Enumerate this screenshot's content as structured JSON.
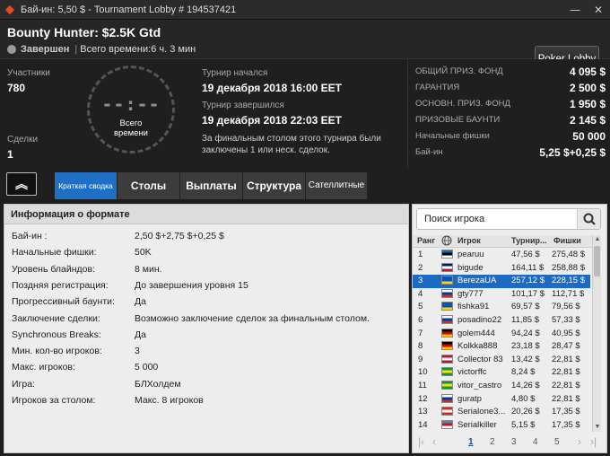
{
  "window": {
    "title": "Бай-ин: 5,50 $ - Tournament Lobby # 194537421",
    "minimize": "—",
    "close": "✕"
  },
  "header": {
    "name": "Bounty Hunter: $2.5K Gtd",
    "status": "Завершен",
    "total_time": "Всего времени:6 ч. 3 мин",
    "lobby_button": "Poker Lobby"
  },
  "info": {
    "participants_label": "Участники",
    "participants": "780",
    "deals_label": "Сделки",
    "deals": "1",
    "clock_time": "--:--",
    "clock_caption_1": "Всего",
    "clock_caption_2": "времени",
    "started_label": "Турнир начался",
    "started": "19 декабря 2018   16:00 EET",
    "ended_label": "Турнир завершился",
    "ended": "19 декабря 2018   22:03 EET",
    "note": "За финальным столом этого турнира были заключены 1 или неск. сделок."
  },
  "prizes": [
    {
      "label": "Общий приз. фонд",
      "value": "4 095 $"
    },
    {
      "label": "Гарантия",
      "value": "2 500 $"
    },
    {
      "label": "Основн. приз. фонд",
      "value": "1 950 $"
    },
    {
      "label": "Призовые баунти",
      "value": "2 145 $"
    },
    {
      "label": "Начальные фишки",
      "value": "50 000"
    },
    {
      "label": "Бай-ин",
      "value": "5,25 $+0,25 $"
    }
  ],
  "nav": {
    "up_icon": "︽",
    "tabs": [
      "Краткая сводка",
      "Столы",
      "Выплаты",
      "Структура",
      "Сателлитные"
    ]
  },
  "format": {
    "title": "Информация о формате",
    "rows": [
      {
        "k": "Бай-ин :",
        "v": "2,50 $+2,75 $+0,25 $"
      },
      {
        "k": "Начальные фишки:",
        "v": "50K"
      },
      {
        "k": "Уровень блайндов:",
        "v": "8 мин."
      },
      {
        "k": "Поздняя регистрация:",
        "v": "До завершения уровня 15"
      },
      {
        "k": "Прогрессивный баунти:",
        "v": "Да"
      },
      {
        "k": "Заключение сделки:",
        "v": "Возможно заключение сделок за финальным столом."
      },
      {
        "k": "Synchronous Breaks:",
        "v": "Да"
      },
      {
        "k": "Мин. кол-во игроков:",
        "v": "3"
      },
      {
        "k": "Макс. игроков:",
        "v": "5 000"
      },
      {
        "k": "Игра:",
        "v": "БЛХолдем"
      },
      {
        "k": "Игроков за столом:",
        "v": "Макс. 8 игроков"
      }
    ]
  },
  "players": {
    "search_placeholder": "Поиск игрока",
    "headers": {
      "rank": "Ранг",
      "player": "Игрок",
      "tourney": "Турнир...",
      "chips": "Фишки"
    },
    "rows": [
      {
        "rank": "1",
        "name": "pearuu",
        "t": "47,56 $",
        "c": "275,48 $",
        "flag": [
          "#0072ce",
          "#000000",
          "#ffffff"
        ]
      },
      {
        "rank": "2",
        "name": "bigude",
        "t": "164,11 $",
        "c": "258,88 $",
        "flag": [
          "#012169",
          "#ffffff",
          "#c8102e"
        ]
      },
      {
        "rank": "3",
        "name": "BerezaUA",
        "t": "257,12 $",
        "c": "228,15 $",
        "flag": [
          "#0057b7",
          "#0057b7",
          "#ffd700"
        ]
      },
      {
        "rank": "4",
        "name": "gty777",
        "t": "101,17 $",
        "c": "112,71 $",
        "flag": [
          "#ffffff",
          "#0039a6",
          "#d52b1e"
        ]
      },
      {
        "rank": "5",
        "name": "fishka91",
        "t": "69,57 $",
        "c": "79,56 $",
        "flag": [
          "#0057b7",
          "#0057b7",
          "#ffd700"
        ]
      },
      {
        "rank": "6",
        "name": "posadino22",
        "t": "11,85 $",
        "c": "57,33 $",
        "flag": [
          "#ffffff",
          "#0039a6",
          "#d52b1e"
        ]
      },
      {
        "rank": "7",
        "name": "golem444",
        "t": "94,24 $",
        "c": "40,95 $",
        "flag": [
          "#000000",
          "#dd0000",
          "#ffce00"
        ]
      },
      {
        "rank": "8",
        "name": "Kolkka888",
        "t": "23,18 $",
        "c": "28,47 $",
        "flag": [
          "#000000",
          "#dd0000",
          "#ffce00"
        ]
      },
      {
        "rank": "9",
        "name": "Collector 83",
        "t": "13,42 $",
        "c": "22,81 $",
        "flag": [
          "#c60c30",
          "#ffffff",
          "#c60c30"
        ]
      },
      {
        "rank": "10",
        "name": "victorffc",
        "t": "8,24 $",
        "c": "22,81 $",
        "flag": [
          "#009c3b",
          "#ffdf00",
          "#009c3b"
        ]
      },
      {
        "rank": "11",
        "name": "vitor_castro",
        "t": "14,26 $",
        "c": "22,81 $",
        "flag": [
          "#009c3b",
          "#ffdf00",
          "#009c3b"
        ]
      },
      {
        "rank": "12",
        "name": "guratp",
        "t": "4,80 $",
        "c": "22,81 $",
        "flag": [
          "#ffffff",
          "#0039a6",
          "#d52b1e"
        ]
      },
      {
        "rank": "13",
        "name": "Serialone3...",
        "t": "20,26 $",
        "c": "17,35 $",
        "flag": [
          "#d52b1e",
          "#ffffff",
          "#d52b1e"
        ]
      },
      {
        "rank": "14",
        "name": "Serialkiller",
        "t": "5,15 $",
        "c": "17,35 $",
        "flag": [
          "#5b7fb0",
          "#c8102e",
          "#ffffff"
        ]
      }
    ],
    "pages": [
      "1",
      "2",
      "3",
      "4",
      "5"
    ],
    "current_page": "1"
  },
  "colors": {
    "accent": "#1f6fc4",
    "brand": "#e04b24"
  }
}
